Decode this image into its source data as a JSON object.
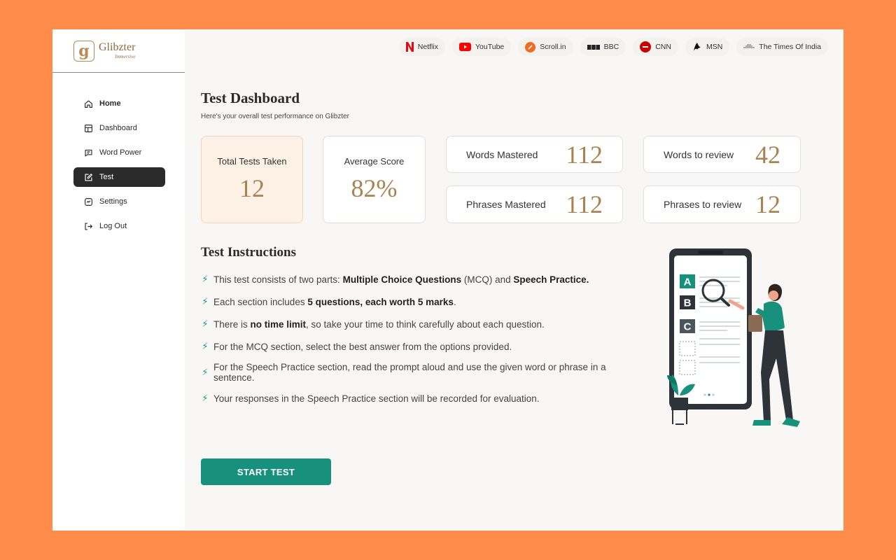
{
  "brand": {
    "name": "Glibzter",
    "tagline": "Immersive",
    "mark": "g"
  },
  "sidebar": {
    "items": [
      {
        "label": "Home",
        "icon": "home-icon"
      },
      {
        "label": "Dashboard",
        "icon": "dashboard-icon"
      },
      {
        "label": "Word Power",
        "icon": "chat-icon"
      },
      {
        "label": "Test",
        "icon": "edit-icon",
        "active": true
      },
      {
        "label": "Settings",
        "icon": "settings-icon"
      },
      {
        "label": "Log Out",
        "icon": "logout-icon"
      }
    ]
  },
  "news_sources": [
    {
      "label": "Netflix",
      "icon": "netflix-icon"
    },
    {
      "label": "YouTube",
      "icon": "youtube-icon"
    },
    {
      "label": "Scroll.in",
      "icon": "scroll-icon"
    },
    {
      "label": "BBC",
      "icon": "bbc-icon"
    },
    {
      "label": "CNN",
      "icon": "cnn-icon"
    },
    {
      "label": "MSN",
      "icon": "msn-icon"
    },
    {
      "label": "The Times Of India",
      "icon": "toi-icon"
    }
  ],
  "dashboard": {
    "title": "Test Dashboard",
    "subtitle": "Here's your overall test performance on Glibzter"
  },
  "stats": {
    "total_tests": {
      "label": "Total Tests Taken",
      "value": "12"
    },
    "average_score": {
      "label": "Average Score",
      "value": "82%"
    },
    "words_mastered": {
      "label": "Words Mastered",
      "value": "112"
    },
    "words_review": {
      "label": "Words to review",
      "value": "42"
    },
    "phrases_mastered": {
      "label": "Phrases Mastered",
      "value": "112"
    },
    "phrases_review": {
      "label": "Phrases to review",
      "value": "12"
    }
  },
  "instructions": {
    "title": "Test Instructions",
    "items": [
      {
        "parts": [
          {
            "text": "This test consists of two parts: ",
            "bold": false
          },
          {
            "text": "Multiple Choice Questions",
            "bold": true
          },
          {
            "text": " (MCQ) and ",
            "bold": false
          },
          {
            "text": "Speech Practice.",
            "bold": true
          }
        ]
      },
      {
        "parts": [
          {
            "text": "Each section includes ",
            "bold": false
          },
          {
            "text": "5 questions, each worth 5 marks",
            "bold": true
          },
          {
            "text": ".",
            "bold": false
          }
        ]
      },
      {
        "parts": [
          {
            "text": "There is ",
            "bold": false
          },
          {
            "text": "no time limit",
            "bold": true
          },
          {
            "text": ", so take your time to think carefully about each question.",
            "bold": false
          }
        ]
      },
      {
        "parts": [
          {
            "text": "For the MCQ section, select the best answer from the options provided.",
            "bold": false
          }
        ]
      },
      {
        "parts": [
          {
            "text": "For the Speech Practice section, read the prompt aloud and use the given word or phrase in a sentence.",
            "bold": false
          }
        ]
      },
      {
        "parts": [
          {
            "text": "Your responses in the Speech Practice section will be recorded for evaluation.",
            "bold": false
          }
        ]
      }
    ]
  },
  "illustration": {
    "options": [
      "A",
      "B",
      "C"
    ]
  },
  "start_button": {
    "label": "START TEST"
  },
  "colors": {
    "accent_teal": "#17917C",
    "stat_gold": "#A88352",
    "page_bg": "#FF8C4B",
    "active_nav": "#2b2b2b"
  }
}
